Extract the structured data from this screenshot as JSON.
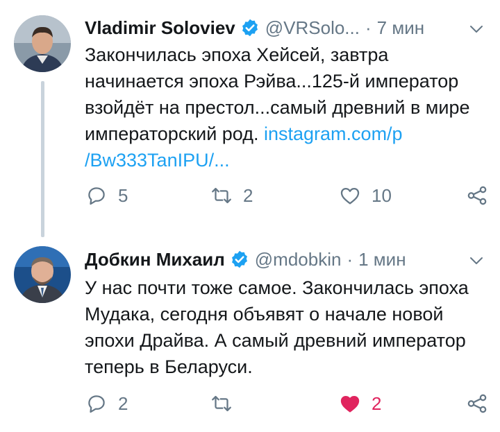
{
  "tweets": [
    {
      "name": "Vladimir Soloviev",
      "handle": "@VRSolo...",
      "dot": "·",
      "time": "7 мин",
      "text_before": "Закончилась эпоха Хейсей, завтра начинается эпоха Рэйва...125-й император взойдёт на престол...самый древний в мире императорский род. ",
      "link_line1": "instagram.com/p",
      "link_line2": "/Bw333TanIPU/...",
      "replies": "5",
      "retweets": "2",
      "likes": "10",
      "liked": false
    },
    {
      "name": "Добкин Михаил",
      "handle": "@mdobkin",
      "dot": "·",
      "time": "1 мин",
      "text": "У нас почти тоже самое. Закончилась эпоха Мудака, сегодня объявят о начале новой эпохи Драйва. А самый древний император теперь в Беларуси.",
      "replies": "2",
      "retweets": "",
      "likes": "2",
      "liked": true
    }
  ],
  "colors": {
    "accent": "#1da1f2",
    "like": "#e0245e",
    "muted": "#657786",
    "thread_line": "#c9d3dc"
  },
  "icons": {
    "verified": "verified-badge-icon",
    "menu": "chevron-down-icon",
    "reply": "reply-icon",
    "retweet": "retweet-icon",
    "like": "heart-icon",
    "share": "share-icon"
  }
}
